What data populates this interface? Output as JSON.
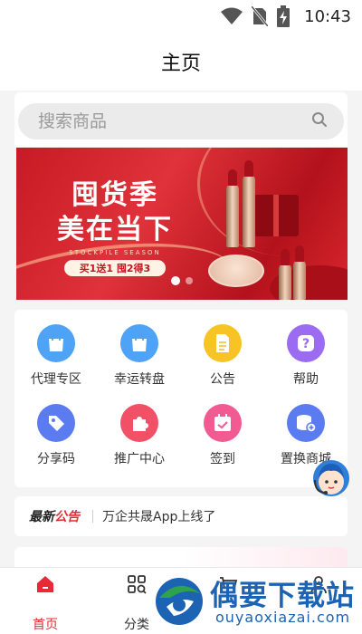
{
  "status_bar": {
    "time": "10:43"
  },
  "header": {
    "title": "主页"
  },
  "search": {
    "placeholder": "搜索商品"
  },
  "banner": {
    "line1": "囤货季",
    "line2": "美在当下",
    "subtitle": "STOCKPILE SEASON",
    "promo": "买1送1 囤2得3",
    "slide_count": 2,
    "active_slide": 1
  },
  "menu": {
    "items": [
      {
        "label": "代理专区",
        "icon": "shopping-bag-icon",
        "color": "#4fa3f7"
      },
      {
        "label": "幸运转盘",
        "icon": "shopping-bag-icon",
        "color": "#4fa3f7"
      },
      {
        "label": "公告",
        "icon": "document-icon",
        "color": "#f7c325"
      },
      {
        "label": "帮助",
        "icon": "question-icon",
        "color": "#9b6cf2"
      },
      {
        "label": "分享码",
        "icon": "tag-icon",
        "color": "#5b7cf0"
      },
      {
        "label": "推广中心",
        "icon": "puzzle-icon",
        "color": "#f25066"
      },
      {
        "label": "签到",
        "icon": "calendar-icon",
        "color": "#f25a92"
      },
      {
        "label": "置换商城",
        "icon": "database-plus-icon",
        "color": "#5b7cf0"
      }
    ]
  },
  "notice": {
    "tag_part1": "最新",
    "tag_part2": "公告",
    "text": "万企共晟App上线了"
  },
  "bottom_nav": {
    "items": [
      {
        "label": "首页",
        "active": true
      },
      {
        "label": "分类",
        "active": false
      }
    ]
  },
  "watermark": {
    "title": "偶要下载站",
    "url": "ouyaoxiazai.com"
  },
  "colors": {
    "accent": "#e62a36",
    "banner_red": "#c71a24"
  }
}
